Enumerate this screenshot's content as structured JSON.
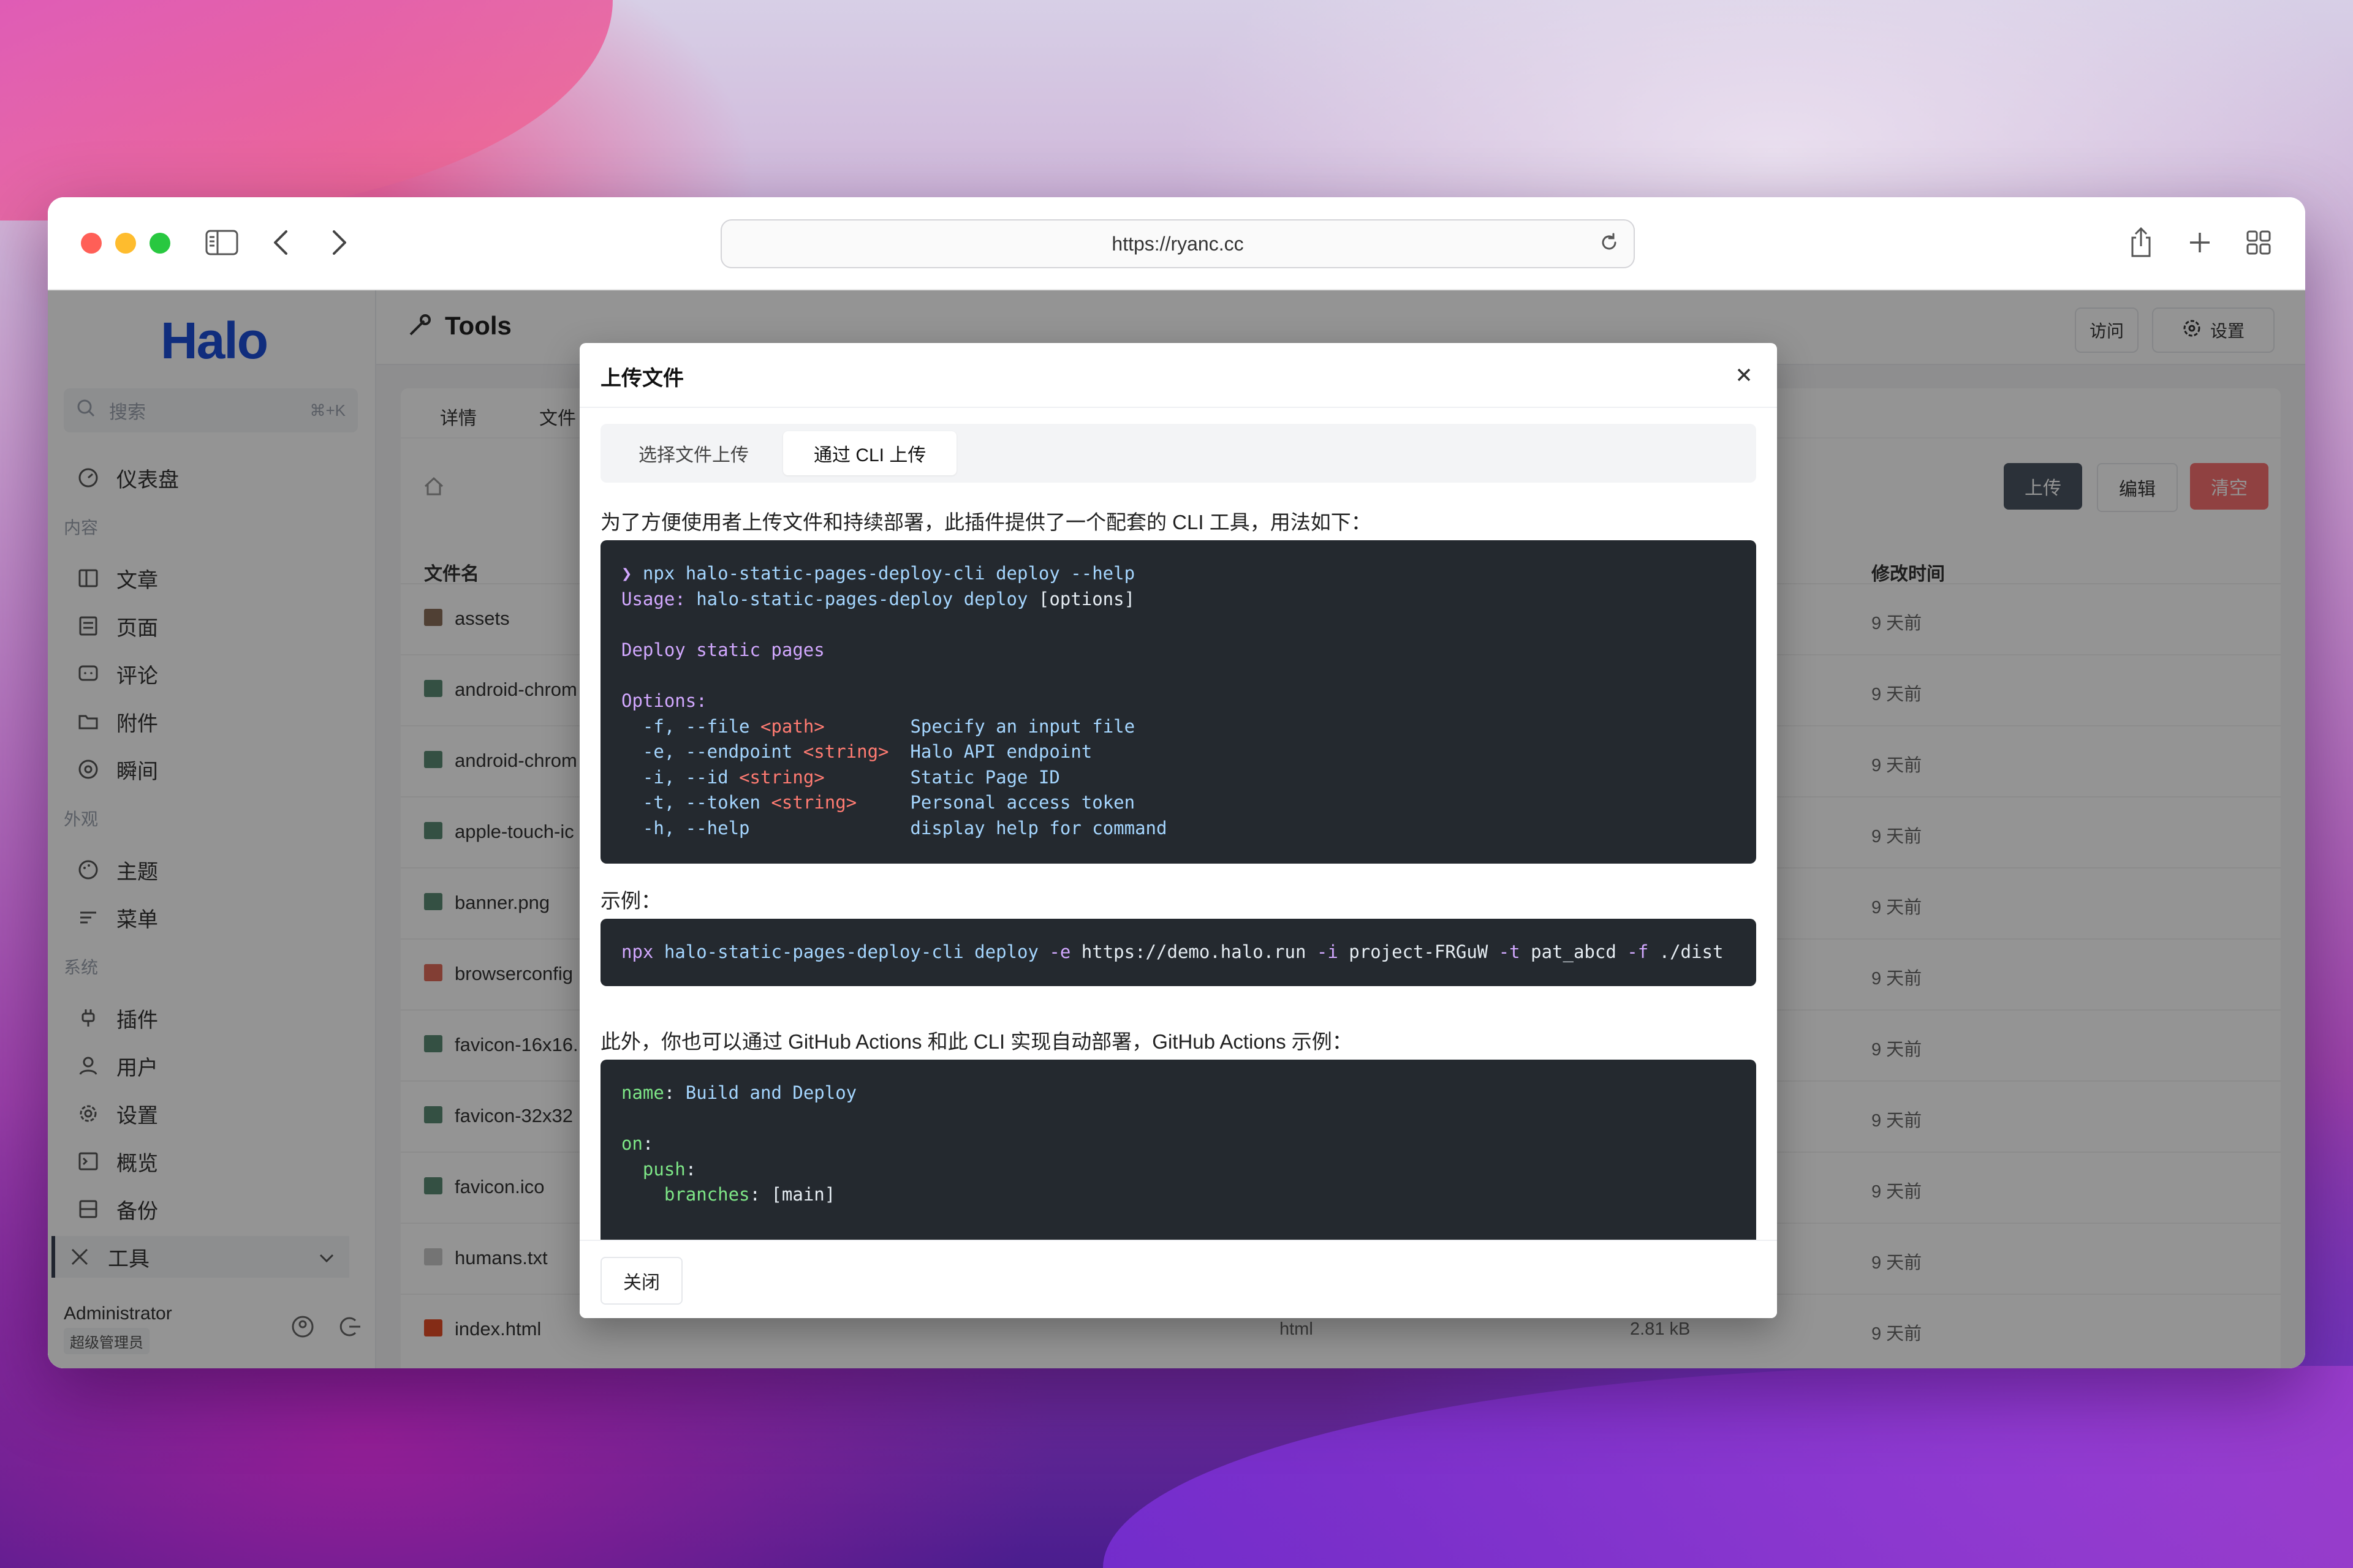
{
  "browser": {
    "url": "https://ryanc.cc"
  },
  "sidebar": {
    "logo": "Halo",
    "search_placeholder": "搜索",
    "search_shortcut": "⌘+K",
    "dashboard": "仪表盘",
    "group_content": "内容",
    "posts": "文章",
    "pages": "页面",
    "comments": "评论",
    "attachments": "附件",
    "moments": "瞬间",
    "group_appearance": "外观",
    "themes": "主题",
    "menus": "菜单",
    "group_system": "系统",
    "plugins": "插件",
    "users": "用户",
    "settings": "设置",
    "overview": "概览",
    "backup": "备份",
    "tools": "工具",
    "user_name": "Administrator",
    "user_role": "超级管理员"
  },
  "header": {
    "title": "Tools",
    "visit_label": "访问",
    "settings_label": "设置"
  },
  "content": {
    "tab_details": "详情",
    "tab_files": "文件",
    "upload_label": "上传",
    "edit_label": "编辑",
    "clear_label": "清空",
    "col_name": "文件名",
    "col_modified": "修改时间",
    "files": [
      {
        "name": "assets",
        "time": "9 天前",
        "kind": "folder"
      },
      {
        "name": "android-chrom",
        "time": "9 天前",
        "kind": "image"
      },
      {
        "name": "android-chrom",
        "time": "9 天前",
        "kind": "image"
      },
      {
        "name": "apple-touch-ic",
        "time": "9 天前",
        "kind": "image"
      },
      {
        "name": "banner.png",
        "time": "9 天前",
        "kind": "image"
      },
      {
        "name": "browserconfig",
        "time": "9 天前",
        "kind": "code"
      },
      {
        "name": "favicon-16x16.",
        "time": "9 天前",
        "kind": "image"
      },
      {
        "name": "favicon-32x32",
        "time": "9 天前",
        "kind": "image"
      },
      {
        "name": "favicon.ico",
        "time": "9 天前",
        "kind": "image"
      },
      {
        "name": "humans.txt",
        "time": "9 天前",
        "kind": "text"
      },
      {
        "name": "index.html",
        "type": "html",
        "size": "2.81 kB",
        "time": "9 天前",
        "kind": "html"
      }
    ]
  },
  "modal": {
    "title": "上传文件",
    "tab_select": "选择文件上传",
    "tab_cli": "通过 CLI 上传",
    "intro": "为了方便使用者上传文件和持续部署，此插件提供了一个配套的 CLI 工具，用法如下：",
    "example_label": "示例：",
    "actions_intro": "此外，你也可以通过 GitHub Actions 和此 CLI 实现自动部署，GitHub Actions 示例：",
    "help_code": {
      "l1_prompt": "❯ ",
      "l1_cmd": "npx halo-static-pages-deploy-cli deploy --help",
      "l2_a": "Usage: ",
      "l2_b": "halo-static-pages-deploy deploy ",
      "l2_c": "[options]",
      "l3": "Deploy static pages",
      "l4": "Options:",
      "opt1_flag": "  -f, --file ",
      "opt1_arg": "<path>",
      "opt1_pad": "        ",
      "opt1_desc": "Specify an input file",
      "opt2_flag": "  -e, --endpoint ",
      "opt2_arg": "<string>",
      "opt2_pad": "  ",
      "opt2_desc": "Halo API endpoint",
      "opt3_flag": "  -i, --id ",
      "opt3_arg": "<string>",
      "opt3_pad": "        ",
      "opt3_desc": "Static Page ID",
      "opt4_flag": "  -t, --token ",
      "opt4_arg": "<string>",
      "opt4_pad": "     ",
      "opt4_desc": "Personal access token",
      "opt5_flag": "  -h, --help",
      "opt5_pad": "               ",
      "opt5_desc": "display help for command"
    },
    "example_code": {
      "npx": "npx ",
      "cmd": "halo-static-pages-deploy-cli deploy ",
      "e": "-e ",
      "endpoint": "https://demo.halo.run ",
      "i": "-i ",
      "id": "project-FRGuW ",
      "t": "-t ",
      "token": "pat_abcd ",
      "f": "-f ",
      "dir": "./dist"
    },
    "yaml_code": {
      "k1": "name",
      "v1": "Build and Deploy",
      "k2": "on",
      "k3": "  push",
      "k4": "    branches",
      "v4": "[main]"
    },
    "close_label": "关闭"
  }
}
